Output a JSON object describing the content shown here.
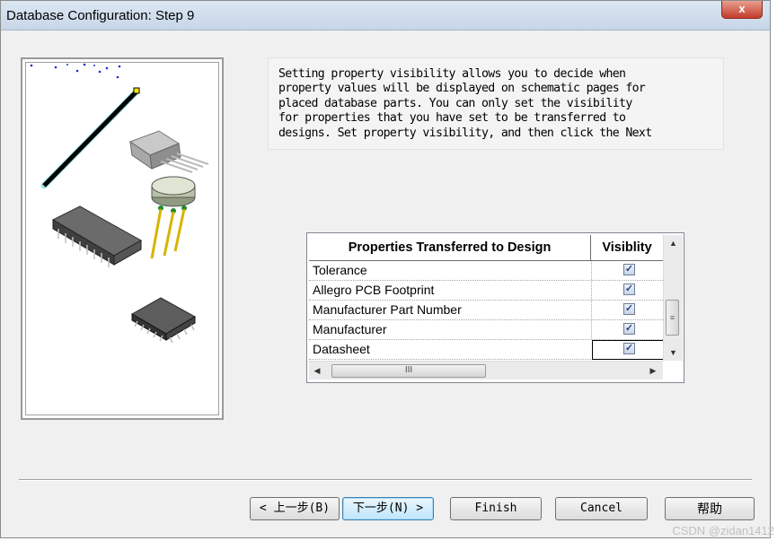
{
  "window": {
    "title": "Database Configuration: Step 9",
    "close_label": "x"
  },
  "description": "Setting property visibility allows you to decide when\nproperty values will be displayed on schematic pages for\nplaced database parts. You can only set the visibility\nfor properties that you have set to be transferred to\ndesigns. Set property visibility, and then click the Next",
  "grid": {
    "headers": [
      "Properties Transferred to Design",
      "Visiblity"
    ],
    "rows": [
      {
        "name": "Tolerance",
        "visible": true
      },
      {
        "name": "Allegro PCB Footprint",
        "visible": true
      },
      {
        "name": "Manufacturer Part Number",
        "visible": true
      },
      {
        "name": "Manufacturer",
        "visible": true
      },
      {
        "name": "Datasheet",
        "visible": true
      }
    ],
    "check_glyph": "✓",
    "hthumb_glyph": "III",
    "vthumb_glyph": "≡"
  },
  "buttons": {
    "back": "< 上一步(B)",
    "next": "下一步(N) >",
    "finish": "Finish",
    "cancel": "Cancel",
    "help": "帮助"
  },
  "watermark": "CSDN @zidan1412",
  "colors": {
    "accent": "#3c7fb1",
    "check": "#25438a",
    "chip_wand": "#000000"
  },
  "icons": [
    "magic-wand-icon",
    "component-illustration"
  ]
}
